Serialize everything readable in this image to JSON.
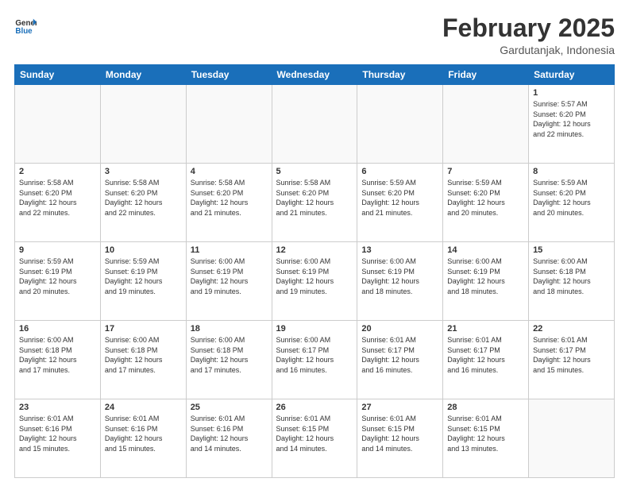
{
  "header": {
    "logo_general": "General",
    "logo_blue": "Blue",
    "month_year": "February 2025",
    "location": "Gardutanjak, Indonesia"
  },
  "days_of_week": [
    "Sunday",
    "Monday",
    "Tuesday",
    "Wednesday",
    "Thursday",
    "Friday",
    "Saturday"
  ],
  "weeks": [
    [
      {
        "day": "",
        "info": ""
      },
      {
        "day": "",
        "info": ""
      },
      {
        "day": "",
        "info": ""
      },
      {
        "day": "",
        "info": ""
      },
      {
        "day": "",
        "info": ""
      },
      {
        "day": "",
        "info": ""
      },
      {
        "day": "1",
        "info": "Sunrise: 5:57 AM\nSunset: 6:20 PM\nDaylight: 12 hours\nand 22 minutes."
      }
    ],
    [
      {
        "day": "2",
        "info": "Sunrise: 5:58 AM\nSunset: 6:20 PM\nDaylight: 12 hours\nand 22 minutes."
      },
      {
        "day": "3",
        "info": "Sunrise: 5:58 AM\nSunset: 6:20 PM\nDaylight: 12 hours\nand 22 minutes."
      },
      {
        "day": "4",
        "info": "Sunrise: 5:58 AM\nSunset: 6:20 PM\nDaylight: 12 hours\nand 21 minutes."
      },
      {
        "day": "5",
        "info": "Sunrise: 5:58 AM\nSunset: 6:20 PM\nDaylight: 12 hours\nand 21 minutes."
      },
      {
        "day": "6",
        "info": "Sunrise: 5:59 AM\nSunset: 6:20 PM\nDaylight: 12 hours\nand 21 minutes."
      },
      {
        "day": "7",
        "info": "Sunrise: 5:59 AM\nSunset: 6:20 PM\nDaylight: 12 hours\nand 20 minutes."
      },
      {
        "day": "8",
        "info": "Sunrise: 5:59 AM\nSunset: 6:20 PM\nDaylight: 12 hours\nand 20 minutes."
      }
    ],
    [
      {
        "day": "9",
        "info": "Sunrise: 5:59 AM\nSunset: 6:19 PM\nDaylight: 12 hours\nand 20 minutes."
      },
      {
        "day": "10",
        "info": "Sunrise: 5:59 AM\nSunset: 6:19 PM\nDaylight: 12 hours\nand 19 minutes."
      },
      {
        "day": "11",
        "info": "Sunrise: 6:00 AM\nSunset: 6:19 PM\nDaylight: 12 hours\nand 19 minutes."
      },
      {
        "day": "12",
        "info": "Sunrise: 6:00 AM\nSunset: 6:19 PM\nDaylight: 12 hours\nand 19 minutes."
      },
      {
        "day": "13",
        "info": "Sunrise: 6:00 AM\nSunset: 6:19 PM\nDaylight: 12 hours\nand 18 minutes."
      },
      {
        "day": "14",
        "info": "Sunrise: 6:00 AM\nSunset: 6:19 PM\nDaylight: 12 hours\nand 18 minutes."
      },
      {
        "day": "15",
        "info": "Sunrise: 6:00 AM\nSunset: 6:18 PM\nDaylight: 12 hours\nand 18 minutes."
      }
    ],
    [
      {
        "day": "16",
        "info": "Sunrise: 6:00 AM\nSunset: 6:18 PM\nDaylight: 12 hours\nand 17 minutes."
      },
      {
        "day": "17",
        "info": "Sunrise: 6:00 AM\nSunset: 6:18 PM\nDaylight: 12 hours\nand 17 minutes."
      },
      {
        "day": "18",
        "info": "Sunrise: 6:00 AM\nSunset: 6:18 PM\nDaylight: 12 hours\nand 17 minutes."
      },
      {
        "day": "19",
        "info": "Sunrise: 6:00 AM\nSunset: 6:17 PM\nDaylight: 12 hours\nand 16 minutes."
      },
      {
        "day": "20",
        "info": "Sunrise: 6:01 AM\nSunset: 6:17 PM\nDaylight: 12 hours\nand 16 minutes."
      },
      {
        "day": "21",
        "info": "Sunrise: 6:01 AM\nSunset: 6:17 PM\nDaylight: 12 hours\nand 16 minutes."
      },
      {
        "day": "22",
        "info": "Sunrise: 6:01 AM\nSunset: 6:17 PM\nDaylight: 12 hours\nand 15 minutes."
      }
    ],
    [
      {
        "day": "23",
        "info": "Sunrise: 6:01 AM\nSunset: 6:16 PM\nDaylight: 12 hours\nand 15 minutes."
      },
      {
        "day": "24",
        "info": "Sunrise: 6:01 AM\nSunset: 6:16 PM\nDaylight: 12 hours\nand 15 minutes."
      },
      {
        "day": "25",
        "info": "Sunrise: 6:01 AM\nSunset: 6:16 PM\nDaylight: 12 hours\nand 14 minutes."
      },
      {
        "day": "26",
        "info": "Sunrise: 6:01 AM\nSunset: 6:15 PM\nDaylight: 12 hours\nand 14 minutes."
      },
      {
        "day": "27",
        "info": "Sunrise: 6:01 AM\nSunset: 6:15 PM\nDaylight: 12 hours\nand 14 minutes."
      },
      {
        "day": "28",
        "info": "Sunrise: 6:01 AM\nSunset: 6:15 PM\nDaylight: 12 hours\nand 13 minutes."
      },
      {
        "day": "",
        "info": ""
      }
    ]
  ]
}
